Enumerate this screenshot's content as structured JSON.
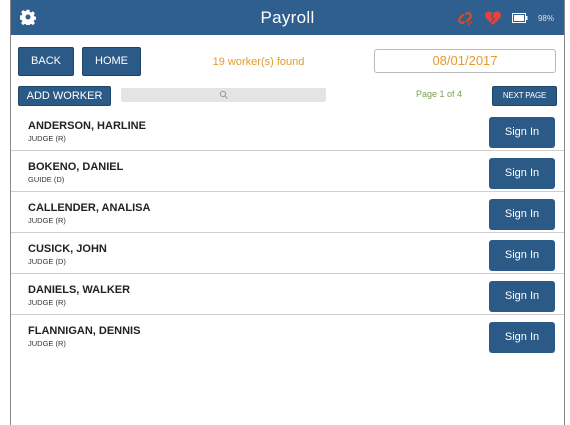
{
  "header": {
    "title": "Payroll",
    "battery_percent": "98%",
    "icons": [
      "gear-icon",
      "broken-link-icon",
      "broken-heart-icon",
      "battery-icon"
    ],
    "colors": {
      "bar": "#2f5f8f",
      "link": "#e04a2a",
      "heart": "#e8413a"
    }
  },
  "toolbar": {
    "back_label": "BACK",
    "home_label": "HOME",
    "found_text": "19 worker(s) found",
    "date": "08/01/2017"
  },
  "subtoolbar": {
    "add_worker_label": "ADD WORKER",
    "search_placeholder": "",
    "page_text": "Page 1 of 4",
    "next_page_label": "NEXT PAGE"
  },
  "workers": [
    {
      "name": "ANDERSON, HARLINE",
      "role": "JUDGE (R)",
      "action": "Sign In"
    },
    {
      "name": "BOKENO, DANIEL",
      "role": "GUIDE (D)",
      "action": "Sign In"
    },
    {
      "name": "CALLENDER, ANALISA",
      "role": "JUDGE (R)",
      "action": "Sign In"
    },
    {
      "name": "CUSICK, JOHN",
      "role": "JUDGE (D)",
      "action": "Sign In"
    },
    {
      "name": "DANIELS, WALKER",
      "role": "JUDGE (R)",
      "action": "Sign In"
    },
    {
      "name": "FLANNIGAN, DENNIS",
      "role": "JUDGE (R)",
      "action": "Sign In"
    }
  ]
}
